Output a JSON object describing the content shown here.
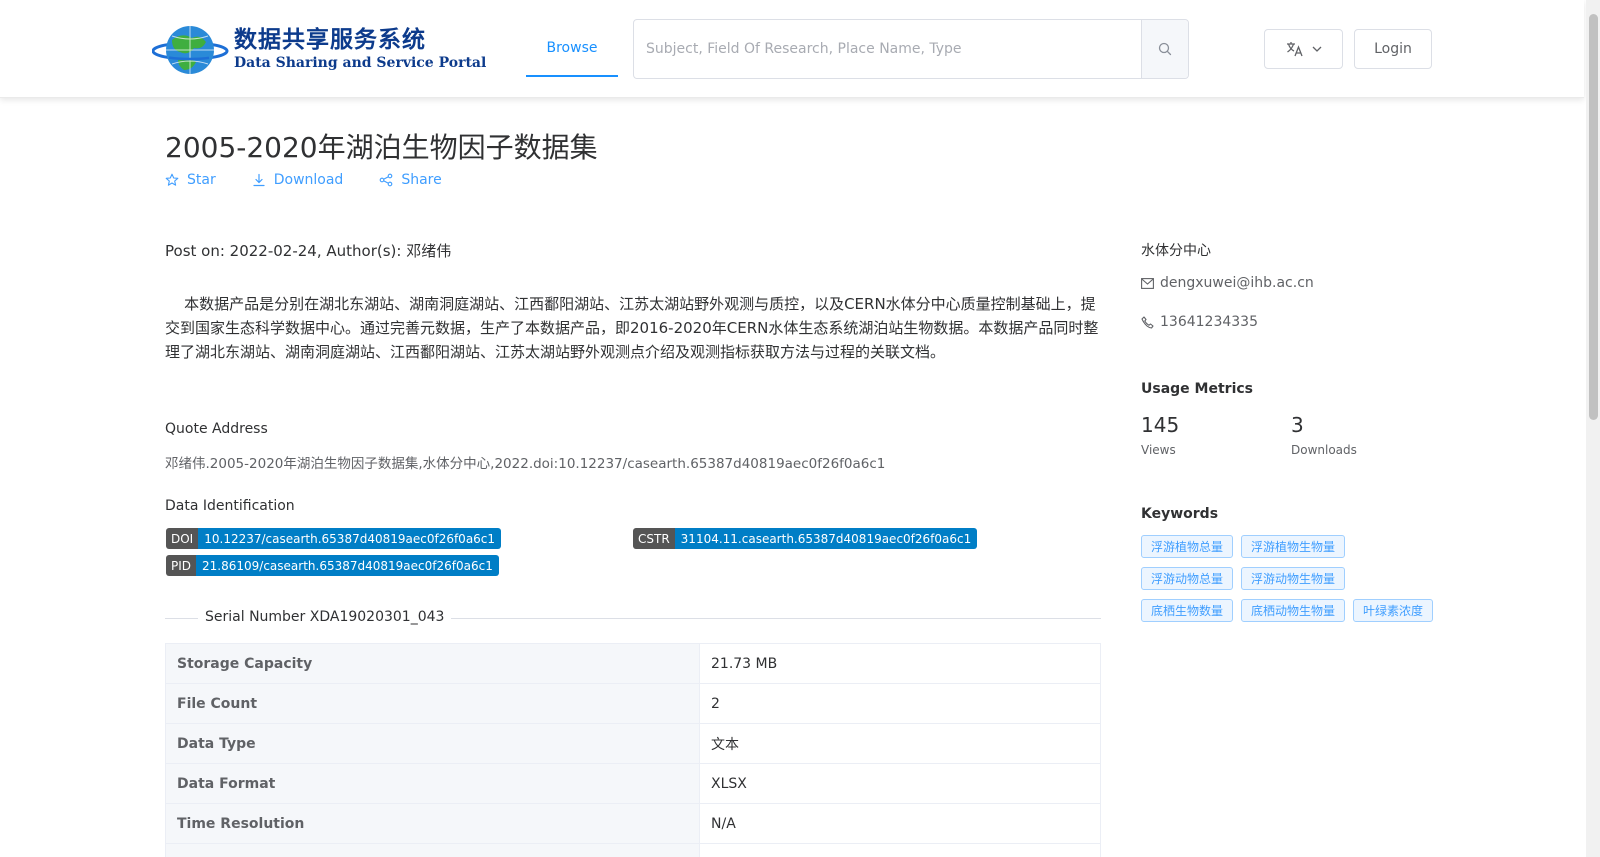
{
  "header": {
    "logo_cn": "数据共享服务系统",
    "logo_en": "Data Sharing and Service Portal",
    "nav_browse": "Browse",
    "search_placeholder": "Subject, Field Of Research, Place Name, Type",
    "login": "Login",
    "icons": {
      "search": "search-icon",
      "lang": "translate-icon",
      "chevron": "chevron-down-icon"
    }
  },
  "dataset": {
    "title": "2005-2020年湖泊生物因子数据集",
    "actions": {
      "star": "Star",
      "download": "Download",
      "share": "Share"
    },
    "post_on": "Post on: 2022-02-24, Author(s): 邓绪伟",
    "abstract": "本数据产品是分别在湖北东湖站、湖南洞庭湖站、江西鄱阳湖站、江苏太湖站野外观测与质控，以及CERN水体分中心质量控制基础上，提交到国家生态科学数据中心。通过完善元数据，生产了本数据产品，即2016-2020年CERN水体生态系统湖泊站生物数据。本数据产品同时整理了湖北东湖站、湖南洞庭湖站、江西鄱阳湖站、江苏太湖站野外观测点介绍及观测指标获取方法与过程的关联文档。",
    "quote_label": "Quote Address",
    "quote_text": "邓绪伟.2005-2020年湖泊生物因子数据集,水体分中心,2022.doi:10.12237/casearth.65387d40819aec0f26f0a6c1",
    "ident_label": "Data Identification",
    "identifiers": {
      "doi_key": "DOI",
      "doi_val": "10.12237/casearth.65387d40819aec0f26f0a6c1",
      "cstr_key": "CSTR",
      "cstr_val": "31104.11.casearth.65387d40819aec0f26f0a6c1",
      "pid_key": "PID",
      "pid_val": "21.86109/casearth.65387d40819aec0f26f0a6c1"
    },
    "serial": "Serial Number XDA19020301_043",
    "table": [
      {
        "k": "Storage Capacity",
        "v": "21.73 MB"
      },
      {
        "k": "File Count",
        "v": "2"
      },
      {
        "k": "Data Type",
        "v": "文本"
      },
      {
        "k": "Data Format",
        "v": "XLSX"
      },
      {
        "k": "Time Resolution",
        "v": "N/A"
      },
      {
        "k": "",
        "v": ""
      }
    ]
  },
  "sidebar": {
    "center_name": "水体分中心",
    "email": "dengxuwei@ihb.ac.cn",
    "phone": "13641234335",
    "metrics_title": "Usage Metrics",
    "views": "145",
    "views_label": "Views",
    "downloads": "3",
    "downloads_label": "Downloads",
    "keywords_title": "Keywords",
    "keywords": [
      "浮游植物总量",
      "浮游植物生物量",
      "浮游动物总量",
      "浮游动物生物量",
      "底栖生物数量",
      "底栖动物生物量",
      "叶绿素浓度"
    ]
  },
  "colors": {
    "accent": "#409eff",
    "badge_key": "#555555",
    "badge_val": "#007ec6",
    "logo": "#0d3b8c"
  }
}
